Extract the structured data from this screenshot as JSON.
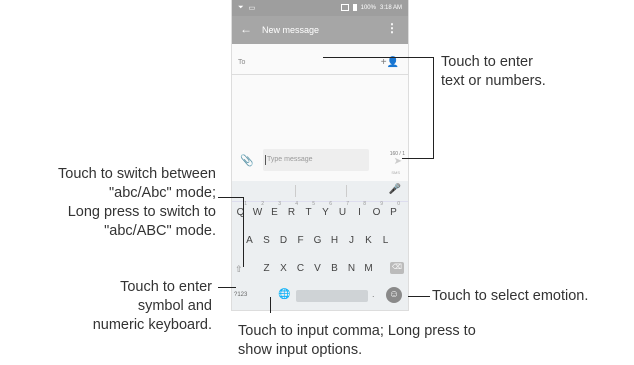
{
  "status_bar": {
    "battery": "100%",
    "time": "3:18 AM"
  },
  "toolbar": {
    "back_icon": "←",
    "title": "New message",
    "more_icon": "⋮"
  },
  "recipient": {
    "label": "To",
    "add_icon": "+👤"
  },
  "compose": {
    "placeholder": "Type message",
    "counter": "160 / 1",
    "send_icon": "➤",
    "send_label": "SMS",
    "attach_icon": "📎"
  },
  "keyboard": {
    "row1": [
      "Q",
      "W",
      "E",
      "R",
      "T",
      "Y",
      "U",
      "I",
      "O",
      "P"
    ],
    "row1_hints": [
      "1",
      "2",
      "3",
      "4",
      "5",
      "6",
      "7",
      "8",
      "9",
      "0"
    ],
    "row2": [
      "A",
      "S",
      "D",
      "F",
      "G",
      "H",
      "J",
      "K",
      "L"
    ],
    "row3": [
      "Z",
      "X",
      "C",
      "V",
      "B",
      "N",
      "M"
    ],
    "symbol_key": "?123",
    "comma_key": ",",
    "period_key": ".",
    "mic_icon": "🎤",
    "shift_icon": "⇧",
    "backspace_icon": "⌫",
    "globe_icon": "🌐",
    "emoji_icon": "☺"
  },
  "callouts": {
    "to_field": "Touch to enter text or numbers.",
    "to_field_line1": "Touch to enter",
    "to_field_line2": "text or numbers.",
    "shift_line1": "Touch to switch between",
    "shift_line2": "\"abc/Abc\" mode;",
    "shift_line3": "Long press to switch to",
    "shift_line4": "\"abc/ABC\" mode.",
    "symbol_line1": "Touch to enter",
    "symbol_line2": "symbol and",
    "symbol_line3": "numeric keyboard.",
    "emoji": "Touch to select emotion.",
    "comma_line1": "Touch to input comma; Long press to",
    "comma_line2": "show input options."
  }
}
